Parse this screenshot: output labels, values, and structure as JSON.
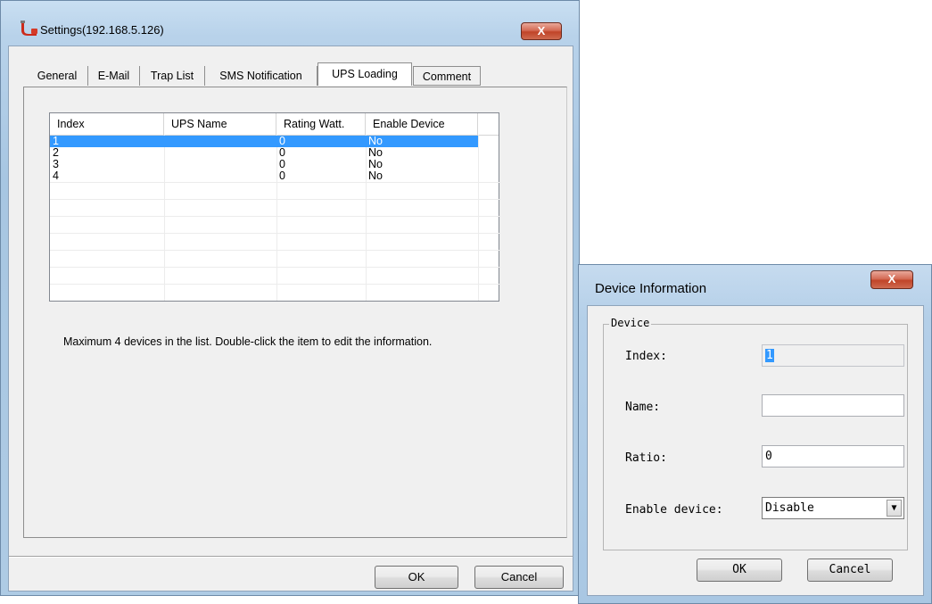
{
  "settings_window": {
    "title": "Settings(192.168.5.126)",
    "close_glyph": "X",
    "tabs": [
      {
        "label": "General"
      },
      {
        "label": "E-Mail"
      },
      {
        "label": "Trap List"
      },
      {
        "label": "SMS Notification"
      },
      {
        "label": "UPS Loading"
      },
      {
        "label": "Comment"
      }
    ],
    "list": {
      "columns": [
        "Index",
        "UPS Name",
        "Rating Watt.",
        "Enable Device"
      ],
      "rows": [
        {
          "index": "1",
          "name": "",
          "rating": "0",
          "enable": "No"
        },
        {
          "index": "2",
          "name": "",
          "rating": "0",
          "enable": "No"
        },
        {
          "index": "3",
          "name": "",
          "rating": "0",
          "enable": "No"
        },
        {
          "index": "4",
          "name": "",
          "rating": "0",
          "enable": "No"
        }
      ]
    },
    "hint": "Maximum 4 devices in the list. Double-click the item to edit the information.",
    "ok_label": "OK",
    "cancel_label": "Cancel"
  },
  "device_dialog": {
    "title": "Device Information",
    "close_glyph": "X",
    "group_label": "Device",
    "index_label": "Index:",
    "index_value": "1",
    "name_label": "Name:",
    "name_value": "",
    "ratio_label": "Ratio:",
    "ratio_value": "0",
    "enable_label": "Enable device:",
    "enable_value": "Disable",
    "ok_label": "OK",
    "cancel_label": "Cancel"
  },
  "icons": {
    "app_icon": "ups-plug-icon",
    "dropdown_arrow": "chevron-down-icon"
  },
  "colors": {
    "selection": "#3399ff",
    "close_button": "#c04428",
    "window_frame": "#b8d2ea"
  }
}
